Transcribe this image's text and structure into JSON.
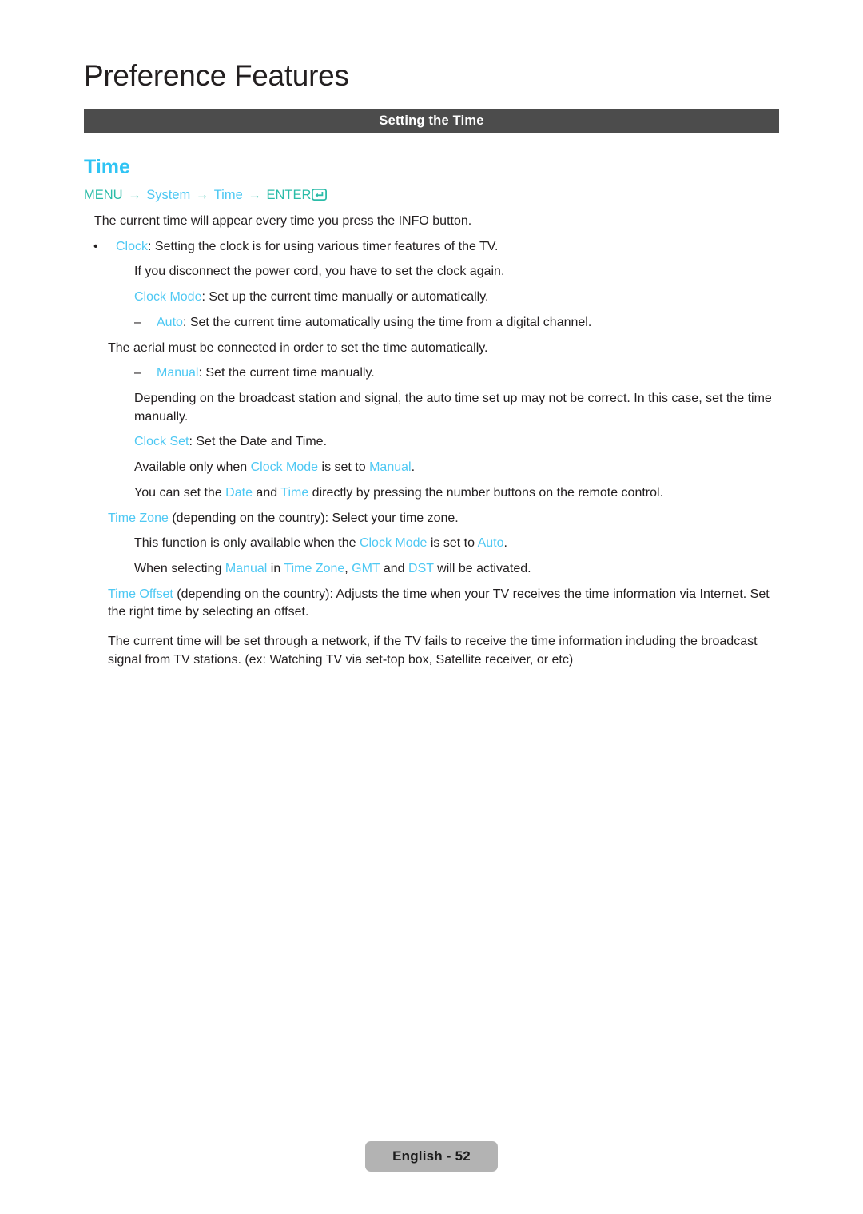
{
  "chapter": {
    "title": "Preference Features"
  },
  "section_bar": {
    "label": "Setting the Time"
  },
  "topic": {
    "heading": "Time"
  },
  "menu_path": {
    "menu": "MENU",
    "arrow1": "→",
    "system": "System",
    "arrow2": "→",
    "time": "Time",
    "arrow3": "→",
    "enter": "ENTER",
    "enter_icon": "enter-return-icon"
  },
  "body": {
    "intro": "The current time will appear every time you press the INFO button.",
    "clock_bullet": {
      "marker": "•",
      "term": "Clock",
      "rest": ": Setting the clock is for using various timer features of the TV."
    },
    "clock_note": "If you disconnect the power cord, you have to set the clock again.",
    "clock_mode": {
      "term": "Clock Mode",
      "rest": ": Set up the current time manually or automatically."
    },
    "auto_dash": {
      "marker": "–",
      "term": "Auto",
      "rest": ": Set the current time automatically using the time from a digital channel."
    },
    "aerial_note": "The aerial must be connected in order to set the time automatically.",
    "manual_dash": {
      "marker": "–",
      "term": "Manual",
      "rest": ": Set the current time manually."
    },
    "depending_note": "Depending on the broadcast station and signal, the auto time set up may not be correct. In this case, set the time manually.",
    "clock_set": {
      "term": "Clock Set",
      "rest": ": Set the Date and Time."
    },
    "available_only": {
      "pre": "Available only when ",
      "term1": "Clock Mode",
      "mid": " is set to ",
      "term2": "Manual",
      "post": "."
    },
    "you_can_set": {
      "pre": "You can set the ",
      "term1": "Date",
      "mid": " and ",
      "term2": "Time",
      "post": " directly by pressing the number buttons on the remote control."
    },
    "time_zone": {
      "term": "Time Zone",
      "rest": " (depending on the country): Select your time zone."
    },
    "this_function": {
      "pre": "This function is only available when the ",
      "term1": "Clock Mode",
      "mid": " is set to ",
      "term2": "Auto",
      "post": "."
    },
    "when_selecting": {
      "pre": "When selecting ",
      "term1": "Manual",
      "mid1": " in ",
      "term2": "Time Zone",
      "mid2": ", ",
      "term3": "GMT",
      "mid3": " and ",
      "term4": "DST",
      "post": " will be activated."
    },
    "time_offset": {
      "term": "Time Offset",
      "rest": " (depending on the country): Adjusts the time when your TV receives the time information via Internet. Set the right time by selecting an offset."
    },
    "network_note": "The current time will be set through a network, if the TV fails to receive the time information including the broadcast signal from TV stations. (ex: Watching TV via set-top box, Satellite receiver, or etc)"
  },
  "footer": {
    "page_label": "English - 52"
  },
  "colors": {
    "term_blue": "#4ec8f3",
    "heading_blue": "#2fc4f4",
    "menu_teal": "#2bbca8",
    "bar_gray": "#4c4c4c",
    "footer_gray": "#b3b3b3",
    "text_black": "#231f20"
  }
}
